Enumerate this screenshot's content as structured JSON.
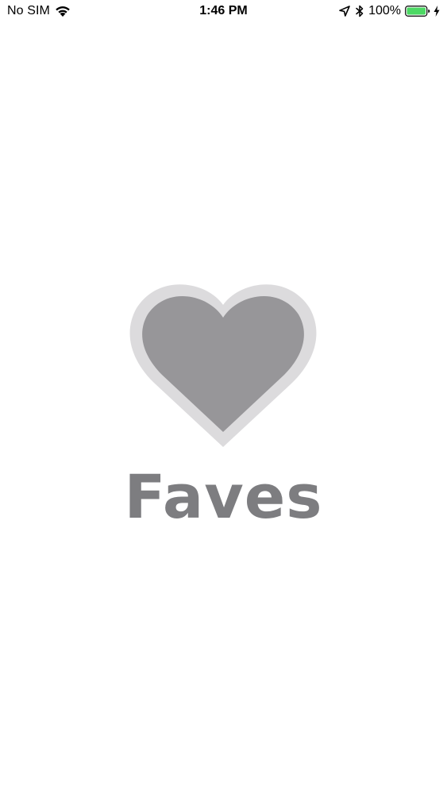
{
  "status_bar": {
    "carrier": "No SIM",
    "time": "1:46 PM",
    "battery_percent": "100%",
    "battery_level": 1.0,
    "battery_color": "#4cd964",
    "icons": [
      "wifi-icon",
      "location-arrow-icon",
      "bluetooth-icon",
      "battery-icon",
      "charging-bolt-icon"
    ]
  },
  "splash": {
    "title": "Faves",
    "icon": "heart-icon",
    "heart_fill_color": "#979699",
    "heart_outline_color": "#dcdbdd",
    "title_color": "#7d7d80"
  }
}
